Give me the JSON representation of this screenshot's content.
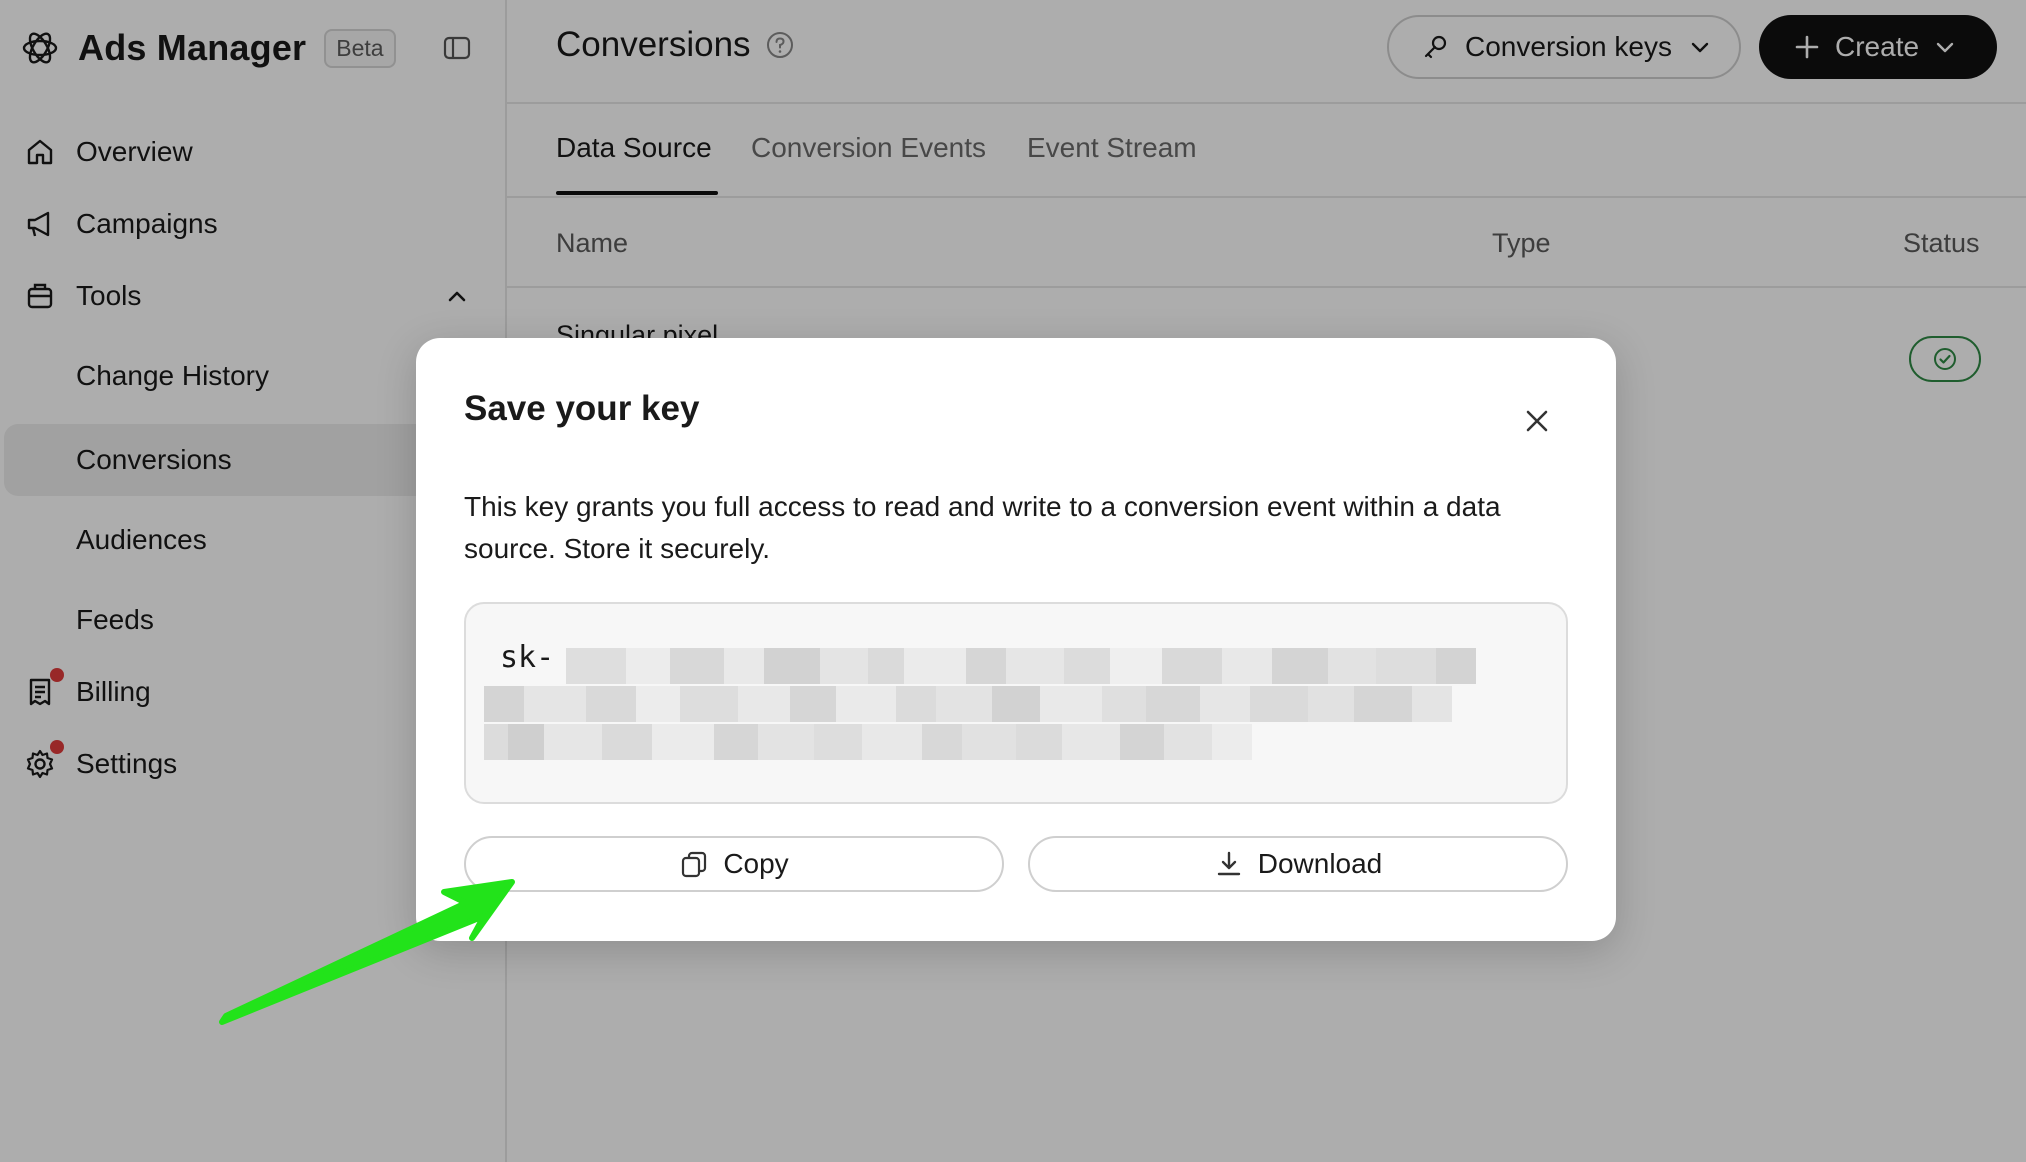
{
  "sidebar": {
    "brand": {
      "title": "Ads Manager",
      "badge": "Beta",
      "logo_icon": "openai-logo-icon"
    },
    "items": [
      {
        "label": "Overview",
        "icon": "home-icon"
      },
      {
        "label": "Campaigns",
        "icon": "megaphone-icon"
      },
      {
        "label": "Tools",
        "icon": "toolbox-icon",
        "expanded": true
      },
      {
        "label": "Change History"
      },
      {
        "label": "Conversions",
        "active": true
      },
      {
        "label": "Audiences"
      },
      {
        "label": "Feeds"
      },
      {
        "label": "Billing",
        "icon": "receipt-icon",
        "notification": true
      },
      {
        "label": "Settings",
        "icon": "gear-icon",
        "notification": true
      }
    ]
  },
  "header": {
    "title": "Conversions",
    "conversion_keys_label": "Conversion keys",
    "create_label": "Create"
  },
  "tabs": [
    {
      "label": "Data Source",
      "active": true
    },
    {
      "label": "Conversion Events"
    },
    {
      "label": "Event Stream"
    }
  ],
  "table": {
    "columns": [
      "Name",
      "Type",
      "Status"
    ],
    "rows": [
      {
        "name": "Singular pixel",
        "status": "active"
      }
    ]
  },
  "modal": {
    "title": "Save your key",
    "description": "This key grants you full access to read and write to a conversion event within a data source. Store it securely.",
    "key_prefix": "sk-",
    "copy_label": "Copy",
    "download_label": "Download"
  },
  "colors": {
    "accent": "#111111",
    "status_green": "#2f8a45",
    "notification_red": "#e03b3b",
    "annotation_arrow": "#22e31a"
  }
}
